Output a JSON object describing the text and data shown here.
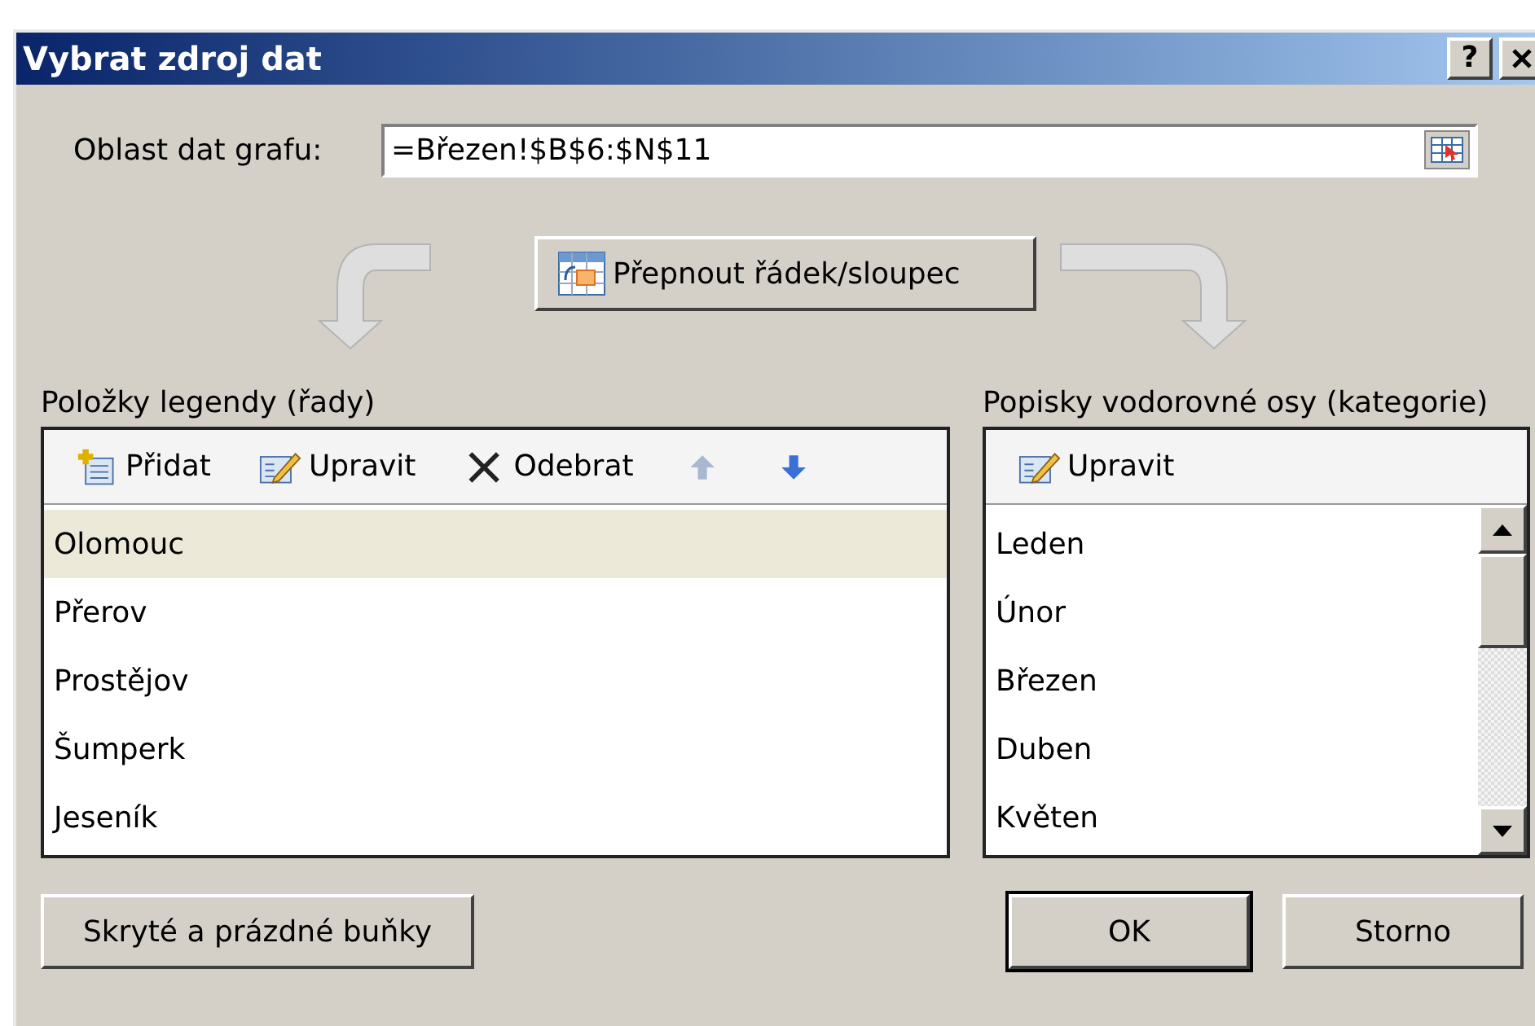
{
  "window": {
    "title": "Vybrat zdroj dat",
    "help_button": "?"
  },
  "data_range": {
    "label": "Oblast dat grafu:",
    "value": "=Březen!$B$6:$N$11"
  },
  "switch_button": "Přepnout řádek/sloupec",
  "legend": {
    "title": "Položky legendy (řady)",
    "toolbar": [
      {
        "kind": "add",
        "label": "Přidat"
      },
      {
        "kind": "edit",
        "label": "Upravit"
      },
      {
        "kind": "remove",
        "label": "Odebrat"
      },
      {
        "kind": "up",
        "disabled": true
      },
      {
        "kind": "down",
        "disabled": false
      }
    ],
    "items": [
      {
        "label": "Olomouc",
        "selected": true
      },
      {
        "label": "Přerov",
        "selected": false
      },
      {
        "label": "Prostějov",
        "selected": false
      },
      {
        "label": "Šumperk",
        "selected": false
      },
      {
        "label": "Jeseník",
        "selected": false
      }
    ]
  },
  "categories": {
    "title": "Popisky vodorovné osy (kategorie)",
    "toolbar": [
      {
        "kind": "edit",
        "label": "Upravit"
      }
    ],
    "items": [
      {
        "label": "Leden",
        "selected": false
      },
      {
        "label": "Únor",
        "selected": false
      },
      {
        "label": "Březen",
        "selected": false
      },
      {
        "label": "Duben",
        "selected": false
      },
      {
        "label": "Květen",
        "selected": false
      }
    ]
  },
  "hidden_cells_button": "Skryté a prázdné buňky",
  "buttons": [
    {
      "label": "OK",
      "default": true
    },
    {
      "label": "Storno",
      "default": false
    }
  ]
}
